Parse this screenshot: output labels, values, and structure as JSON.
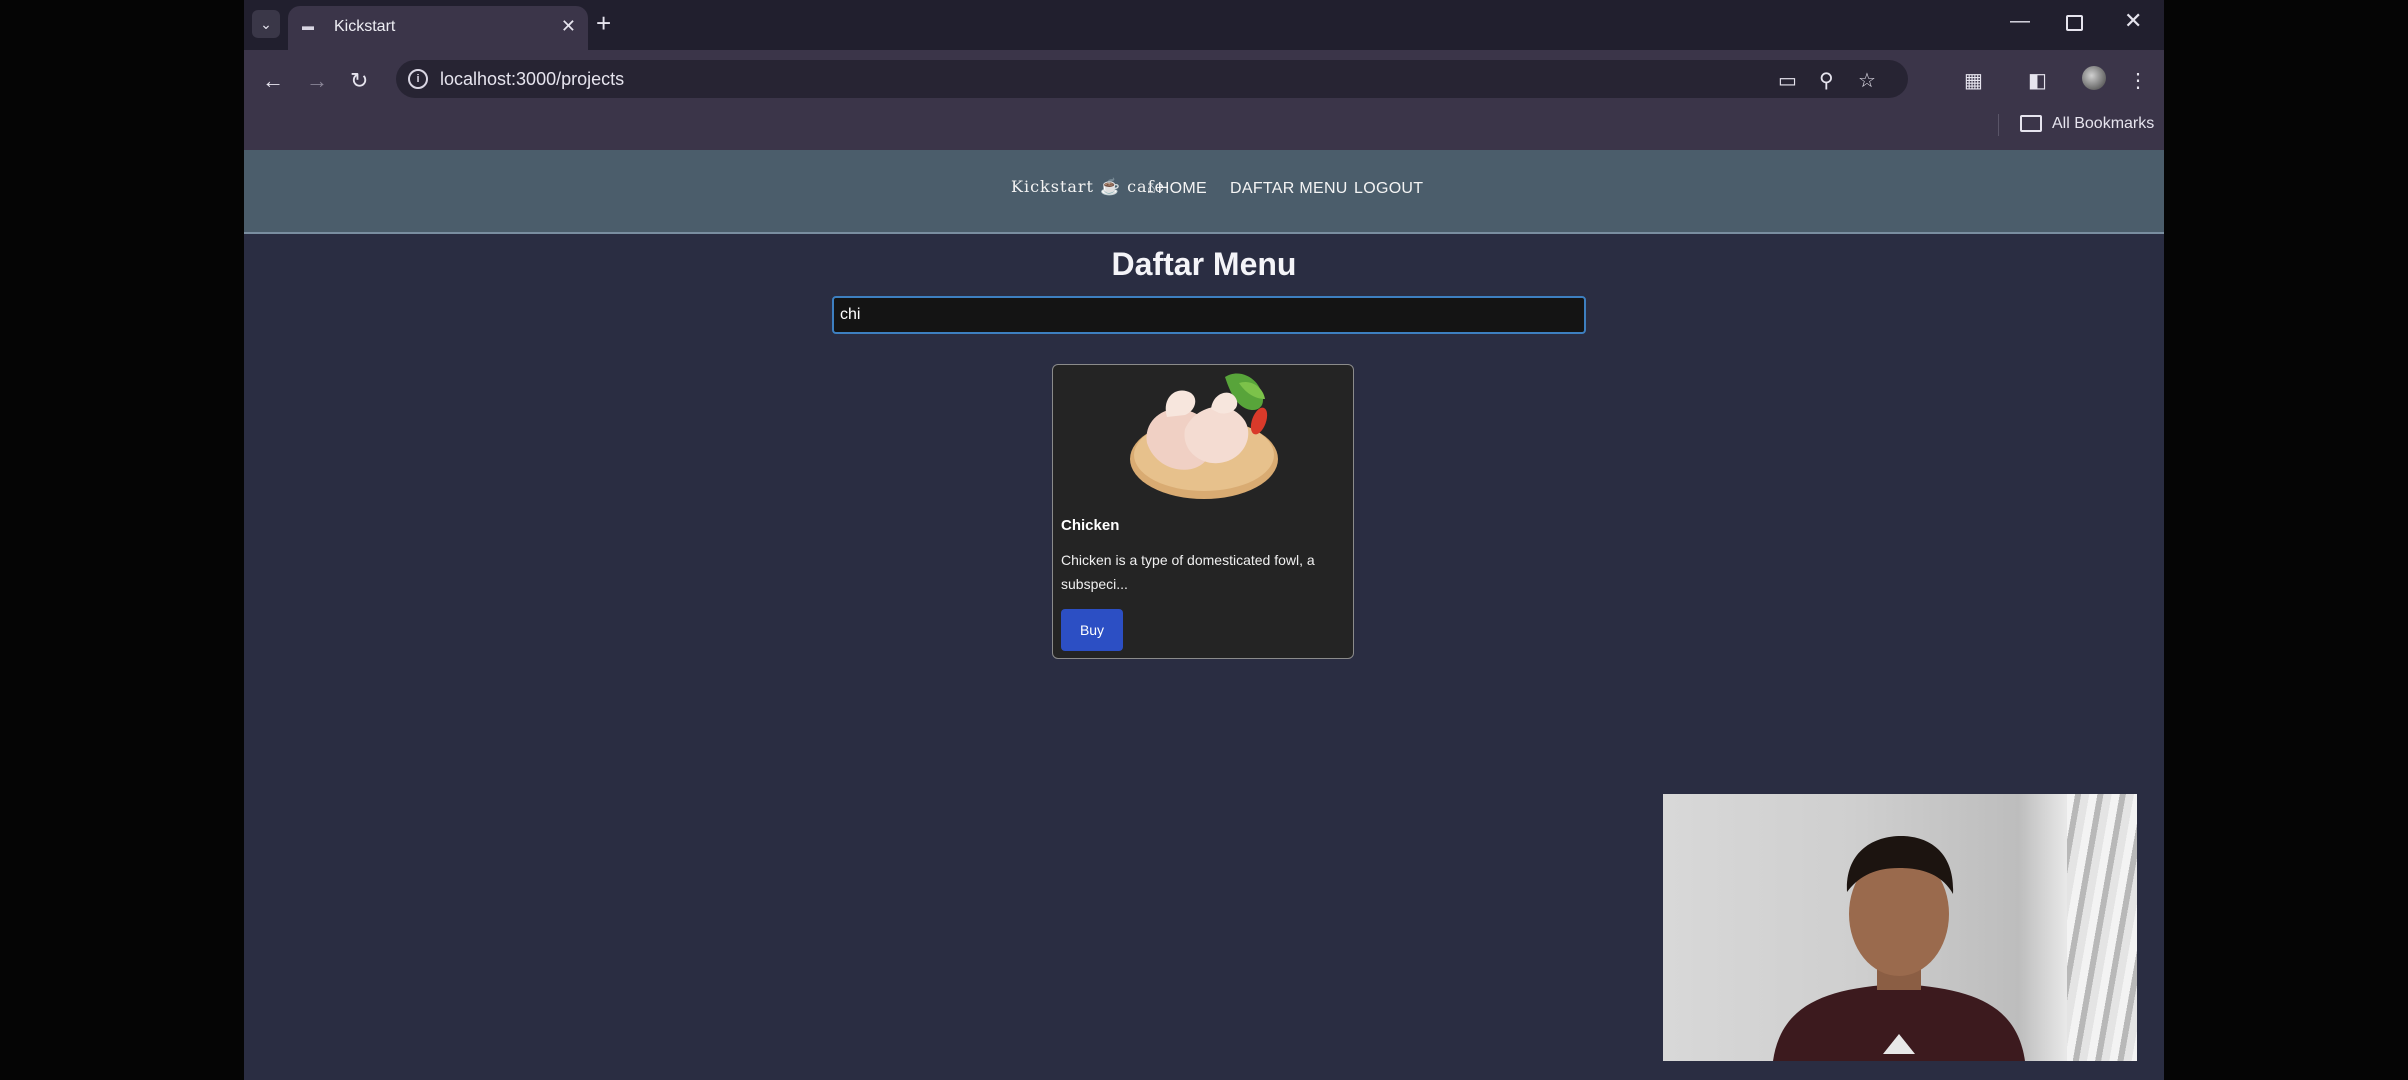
{
  "browser": {
    "tab_title": "Kickstart",
    "url": "localhost:3000/projects",
    "bookmarks_label": "All Bookmarks"
  },
  "site": {
    "logo": "Kickstart ☕ cafe",
    "nav": {
      "home": "HOME",
      "daftar_menu": "DAFTAR MENU",
      "logout": "LOGOUT"
    },
    "page_title": "Daftar Menu",
    "search": {
      "value": "chi",
      "placeholder": ""
    },
    "menu_items": [
      {
        "name": "Chicken",
        "description": "Chicken is a type of domesticated fowl, a subspeci...",
        "buy_label": "Buy"
      }
    ]
  },
  "colors": {
    "page_bg": "#2a2d42",
    "navbar_bg": "#4b5d6b",
    "buy_button": "#2c4fc4",
    "card_bg": "#242424"
  },
  "icons": [
    "tab-list-icon",
    "favicon-icon",
    "close-icon",
    "plus-icon",
    "minimize-icon",
    "restore-icon",
    "back-icon",
    "forward-icon",
    "reload-icon",
    "info-icon",
    "install-icon",
    "zoom-icon",
    "star-icon",
    "extensions-icon",
    "side-panel-icon",
    "profile-icon",
    "menu-icon",
    "folder-icon",
    "home-icon"
  ]
}
